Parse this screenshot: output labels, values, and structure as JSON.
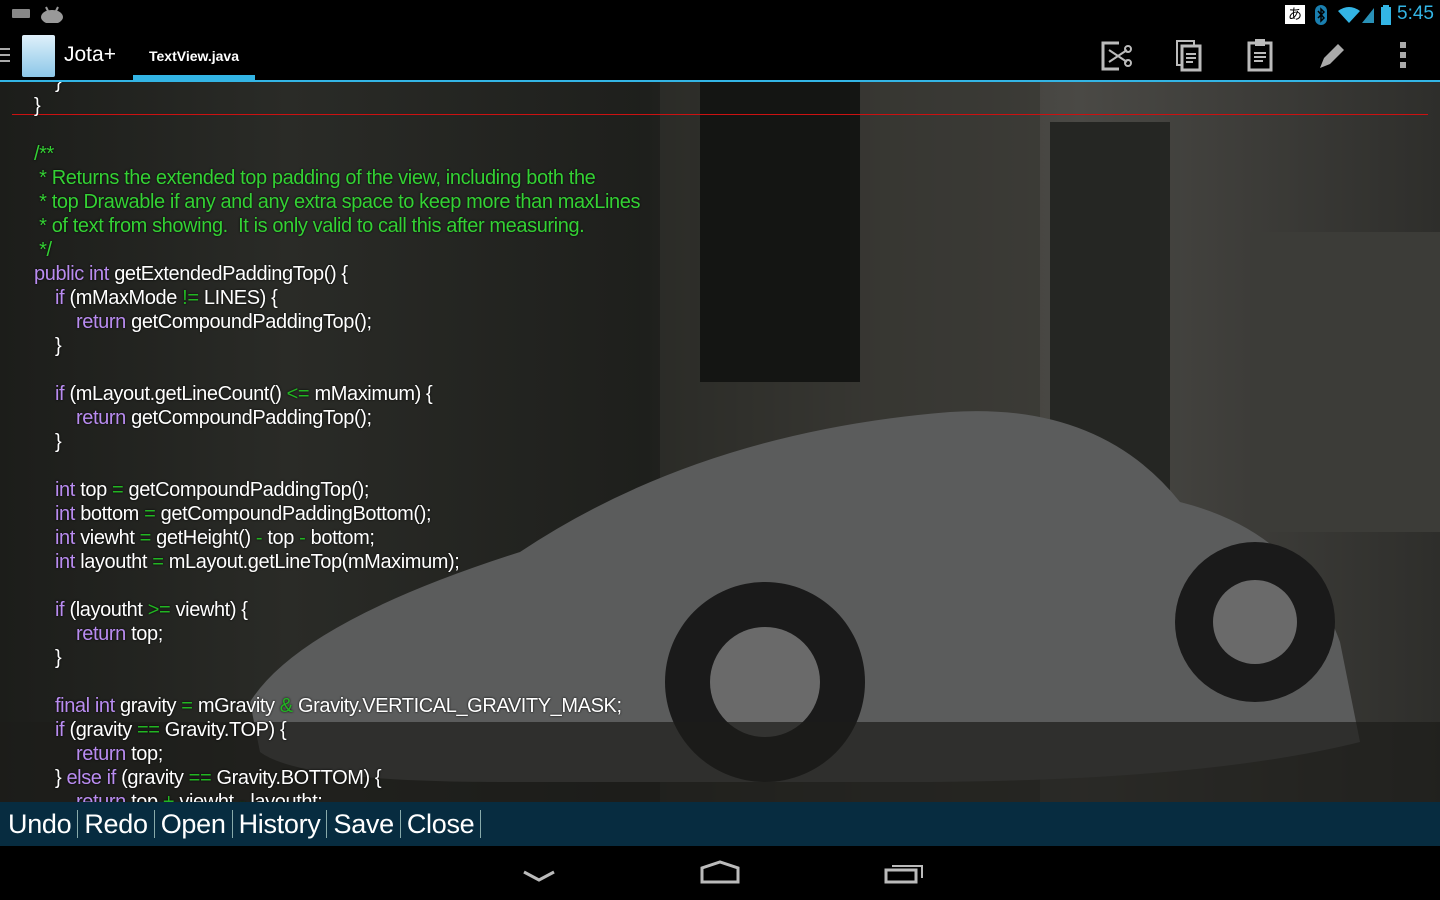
{
  "status_bar": {
    "time": "5:45",
    "ime": "あ",
    "icons": [
      "keyboard-icon",
      "android-icon",
      "bluetooth-icon",
      "wifi-icon",
      "signal-icon",
      "battery-icon"
    ]
  },
  "action_bar": {
    "app_title": "Jota+",
    "logo_text": "Jota+",
    "tab": "TextView.java",
    "actions": [
      "cut-icon",
      "copy-icon",
      "paste-icon",
      "edit-icon",
      "overflow-menu-icon"
    ]
  },
  "colors": {
    "accent": "#33b5e5",
    "keyword": "#b98cf0",
    "operator": "#22b522",
    "comment": "#34d134",
    "bottom_bar": "#072c40",
    "cursor_line": "#cc1111"
  },
  "code_lines": [
    [
      [
        "t",
        "    }"
      ]
    ],
    [
      [
        "t",
        "}"
      ]
    ],
    [],
    [
      [
        "cm",
        "/**"
      ]
    ],
    [
      [
        "cm",
        " * Returns the extended top padding of the view, including both the"
      ]
    ],
    [
      [
        "cm",
        " * top Drawable if any and any extra space to keep more than maxLines"
      ]
    ],
    [
      [
        "cm",
        " * of text from showing.  It is only valid to call this after measuring."
      ]
    ],
    [
      [
        "cm",
        " */"
      ]
    ],
    [
      [
        "kw",
        "public int"
      ],
      [
        "t",
        " getExtendedPaddingTop() {"
      ]
    ],
    [
      [
        "t",
        "    "
      ],
      [
        "kw",
        "if"
      ],
      [
        "t",
        " (mMaxMode "
      ],
      [
        "op",
        "!="
      ],
      [
        "t",
        " LINES) {"
      ]
    ],
    [
      [
        "t",
        "        "
      ],
      [
        "kw",
        "return"
      ],
      [
        "t",
        " getCompoundPaddingTop();"
      ]
    ],
    [
      [
        "t",
        "    }"
      ]
    ],
    [],
    [
      [
        "t",
        "    "
      ],
      [
        "kw",
        "if"
      ],
      [
        "t",
        " (mLayout.getLineCount() "
      ],
      [
        "op",
        "<="
      ],
      [
        "t",
        " mMaximum) {"
      ]
    ],
    [
      [
        "t",
        "        "
      ],
      [
        "kw",
        "return"
      ],
      [
        "t",
        " getCompoundPaddingTop();"
      ]
    ],
    [
      [
        "t",
        "    }"
      ]
    ],
    [],
    [
      [
        "t",
        "    "
      ],
      [
        "kw",
        "int"
      ],
      [
        "t",
        " top "
      ],
      [
        "op",
        "="
      ],
      [
        "t",
        " getCompoundPaddingTop();"
      ]
    ],
    [
      [
        "t",
        "    "
      ],
      [
        "kw",
        "int"
      ],
      [
        "t",
        " bottom "
      ],
      [
        "op",
        "="
      ],
      [
        "t",
        " getCompoundPaddingBottom();"
      ]
    ],
    [
      [
        "t",
        "    "
      ],
      [
        "kw",
        "int"
      ],
      [
        "t",
        " viewht "
      ],
      [
        "op",
        "="
      ],
      [
        "t",
        " getHeight() "
      ],
      [
        "op",
        "-"
      ],
      [
        "t",
        " top "
      ],
      [
        "op",
        "-"
      ],
      [
        "t",
        " bottom;"
      ]
    ],
    [
      [
        "t",
        "    "
      ],
      [
        "kw",
        "int"
      ],
      [
        "t",
        " layoutht "
      ],
      [
        "op",
        "="
      ],
      [
        "t",
        " mLayout.getLineTop(mMaximum);"
      ]
    ],
    [],
    [
      [
        "t",
        "    "
      ],
      [
        "kw",
        "if"
      ],
      [
        "t",
        " (layoutht "
      ],
      [
        "op",
        ">="
      ],
      [
        "t",
        " viewht) {"
      ]
    ],
    [
      [
        "t",
        "        "
      ],
      [
        "kw",
        "return"
      ],
      [
        "t",
        " top;"
      ]
    ],
    [
      [
        "t",
        "    }"
      ]
    ],
    [],
    [
      [
        "t",
        "    "
      ],
      [
        "kw",
        "final int"
      ],
      [
        "t",
        " gravity "
      ],
      [
        "op",
        "="
      ],
      [
        "t",
        " mGravity "
      ],
      [
        "op",
        "&"
      ],
      [
        "t",
        " Gravity.VERTICAL_GRAVITY_MASK;"
      ]
    ],
    [
      [
        "t",
        "    "
      ],
      [
        "kw",
        "if"
      ],
      [
        "t",
        " (gravity "
      ],
      [
        "op",
        "=="
      ],
      [
        "t",
        " Gravity.TOP) {"
      ]
    ],
    [
      [
        "t",
        "        "
      ],
      [
        "kw",
        "return"
      ],
      [
        "t",
        " top;"
      ]
    ],
    [
      [
        "t",
        "    } "
      ],
      [
        "kw",
        "else if"
      ],
      [
        "t",
        " (gravity "
      ],
      [
        "op",
        "=="
      ],
      [
        "t",
        " Gravity.BOTTOM) {"
      ]
    ],
    [
      [
        "t",
        "        "
      ],
      [
        "kw",
        "return"
      ],
      [
        "t",
        " top "
      ],
      [
        "op",
        "+"
      ],
      [
        "t",
        " viewht "
      ],
      [
        "op",
        "-"
      ],
      [
        "t",
        " layoutht;"
      ]
    ]
  ],
  "bottom_bar": {
    "buttons": [
      "Undo",
      "Redo",
      "Open",
      "History",
      "Save",
      "Close"
    ]
  },
  "nav_bar": [
    "back-icon",
    "home-icon",
    "recent-apps-icon"
  ]
}
